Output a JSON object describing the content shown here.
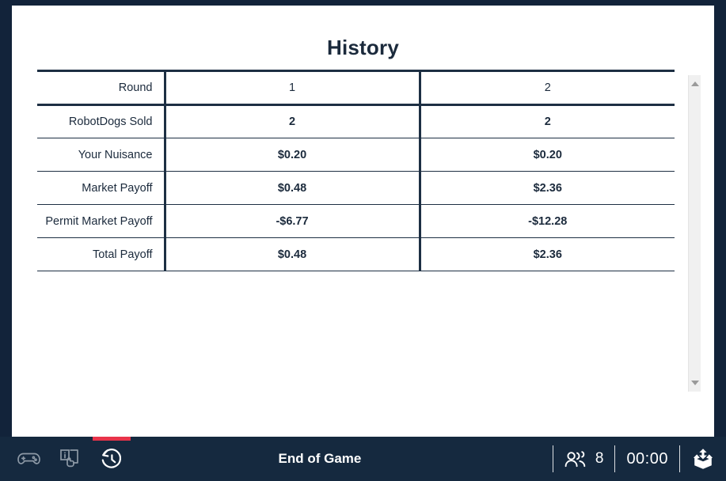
{
  "page": {
    "title": "History"
  },
  "history_table": {
    "rows": [
      {
        "label": "Round",
        "values": [
          "1",
          "2"
        ]
      },
      {
        "label": "RobotDogs Sold",
        "values": [
          "2",
          "2"
        ]
      },
      {
        "label": "Your Nuisance",
        "values": [
          "$0.20",
          "$0.20"
        ]
      },
      {
        "label": "Market Payoff",
        "values": [
          "$0.48",
          "$2.36"
        ]
      },
      {
        "label": "Permit Market Payoff",
        "values": [
          "-$6.77",
          "-$12.28"
        ]
      },
      {
        "label": "Total Payoff",
        "values": [
          "$0.48",
          "$2.36"
        ]
      }
    ]
  },
  "toolbar": {
    "nav": [
      {
        "name": "gamepad",
        "label": "Game",
        "active": false
      },
      {
        "name": "instructions",
        "label": "Instructions",
        "active": false
      },
      {
        "name": "history",
        "label": "History",
        "active": true
      }
    ],
    "status_text": "End of Game",
    "players_count": "8",
    "timer": "00:00",
    "logo_label": "oTree"
  },
  "colors": {
    "frame": "#12233a",
    "toolbar": "#15293f",
    "accent": "#e8334a",
    "table_border": "#1d2f43",
    "text_dark": "#1b2a3c",
    "scrollbar_track": "#f0f0f0",
    "scrollbar_arrow": "#9a9a9a"
  }
}
